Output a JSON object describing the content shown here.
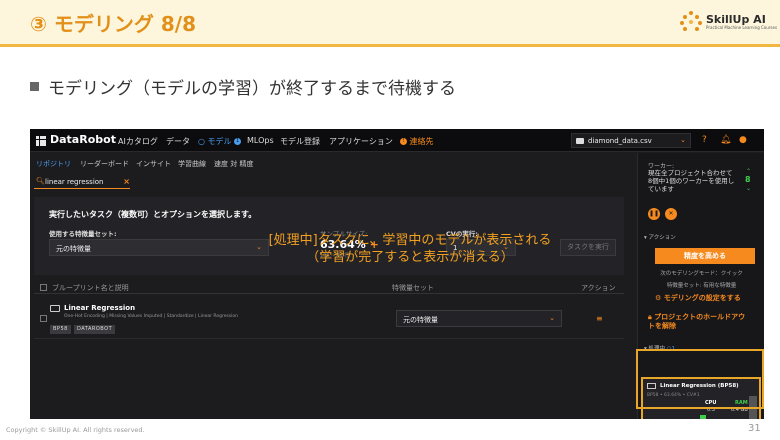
{
  "slide": {
    "title": "③ モデリング 8/8",
    "bullet": "モデリング（モデルの学習）が終了するまで待機する",
    "logo_name": "SkillUp AI",
    "logo_tagline": "Practical Machine Learning Courses",
    "footer": "Copyright © SkillUp AI. All rights reserved.",
    "page_number": "31",
    "annotation_line1": "[処理中]タスクに、学習中のモデルが表示される",
    "annotation_line2": "（学習が完了すると表示が消える）",
    "accent_color": "#e2901a"
  },
  "app": {
    "brand_prefix": "Data",
    "brand_suffix": "Robot",
    "nav": [
      "AIカタログ",
      "データ",
      "モデル",
      "MLOps",
      "モデル登録",
      "アプリケーション",
      "連絡先"
    ],
    "model_badge": "1",
    "contact_badge": "!",
    "dataset": "diamond_data.csv",
    "help_icon": "?",
    "subnav": [
      "リポジトリ",
      "リーダーボード",
      "インサイト",
      "学習曲線",
      "速度 対 精度"
    ],
    "search_value": "linear regression",
    "task": {
      "title": "実行したいタスク（複数可）とオプションを選択します。",
      "featureset_label": "使用する特徴量セット:",
      "featureset_value": "元の特徴量",
      "sample_label": "サンプルサイズ:",
      "sample_value": "63.64%",
      "sample_plus": "+",
      "sample_sub": "196／308行",
      "cv_label": "CVの実行:",
      "cv_value": "1",
      "run_button": "タスクを実行"
    },
    "table": {
      "col_blueprint": "ブループリント名と説明",
      "col_featureset": "特徴量セット",
      "col_action": "アクション"
    },
    "row": {
      "model_name": "Linear Regression",
      "description": "One-Hot Encoding | Missing Values Imputed | Standardize | Linear Regression",
      "tag1": "BP58",
      "tag2": "DATAROBOT",
      "featureset": "元の特徴量"
    },
    "sidebar": {
      "workers_label": "ワーカー:",
      "workers_text_1": "現在全プロジェクト合わせて",
      "workers_text_2": "8個中1個のワーカーを使用し",
      "workers_text_3": "ています",
      "workers_count": "8",
      "actions_label": "アクション",
      "accuracy_button": "精度を高める",
      "next_mode": "次のモデリングモード：クイック",
      "featureset_info": "特徴量セット: 有用な特徴量",
      "configure_link": "モデリングの設定をする",
      "unlock_link_1": "プロジェクトのホールドアウ",
      "unlock_link_2": "トを解除",
      "processing_label": "処理中",
      "processing_count": "1"
    },
    "processing_card": {
      "title": "Linear Regression (BP58)",
      "subtitle": "BP58 • 63.64% • CV#1",
      "cpu_label": "CPU",
      "cpu_value": "0.3",
      "ram_label": "RAM",
      "ram_value": "0.4 GB"
    },
    "accent_color": "#f68a1e",
    "highlight_color": "#e9a72a"
  }
}
